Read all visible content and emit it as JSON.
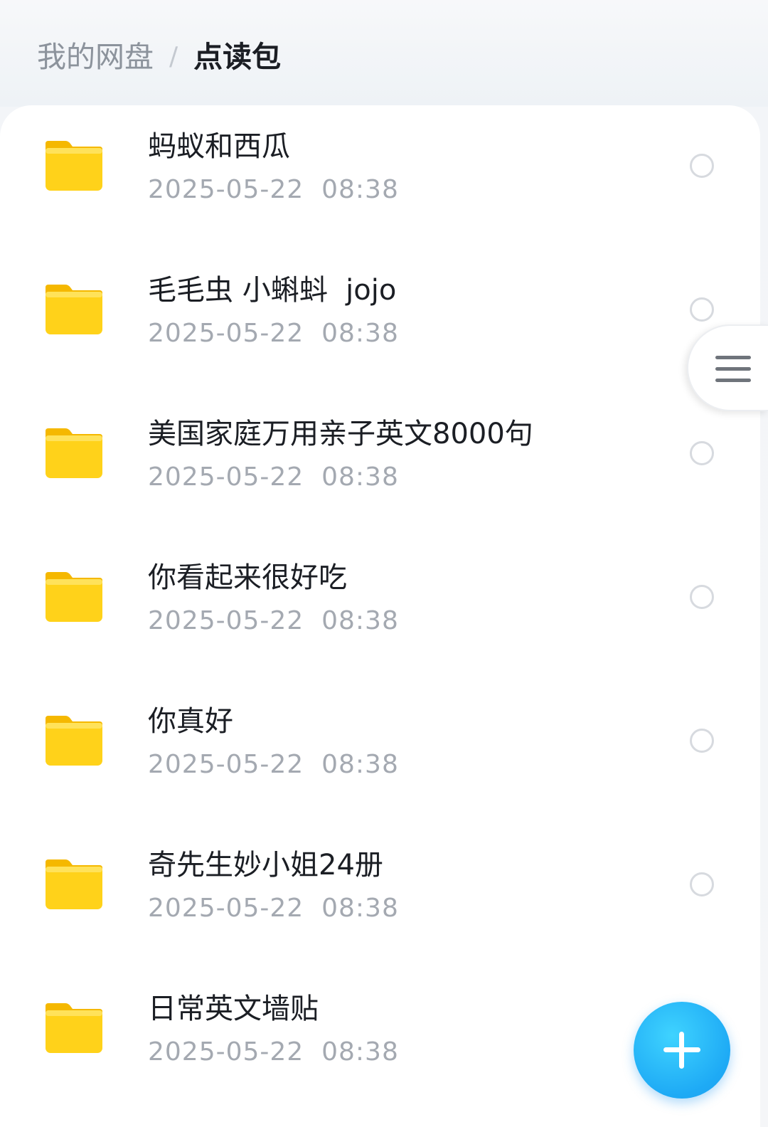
{
  "breadcrumb": {
    "root": "我的网盘",
    "separator": "/",
    "current": "点读包"
  },
  "files": [
    {
      "name": "蚂蚁和西瓜",
      "time": "2025-05-22  08:38",
      "icon": "folder-icon"
    },
    {
      "name": "毛毛虫 小蝌蚪  jojo",
      "time": "2025-05-22  08:38",
      "icon": "folder-icon"
    },
    {
      "name": "美国家庭万用亲子英文8000句",
      "time": "2025-05-22  08:38",
      "icon": "folder-icon"
    },
    {
      "name": "你看起来很好吃",
      "time": "2025-05-22  08:38",
      "icon": "folder-icon"
    },
    {
      "name": "你真好",
      "time": "2025-05-22  08:38",
      "icon": "folder-icon"
    },
    {
      "name": "奇先生妙小姐24册",
      "time": "2025-05-22  08:38",
      "icon": "folder-icon"
    },
    {
      "name": "日常英文墙贴",
      "time": "2025-05-22  08:38",
      "icon": "folder-icon"
    }
  ],
  "side_tab": {
    "icon": "menu-icon"
  },
  "fab": {
    "icon": "plus-icon"
  },
  "colors": {
    "accent": "#1eaaf5",
    "folder": "#ffcc00",
    "title_text": "#1b1e24",
    "secondary_text": "#a4a9b1"
  }
}
